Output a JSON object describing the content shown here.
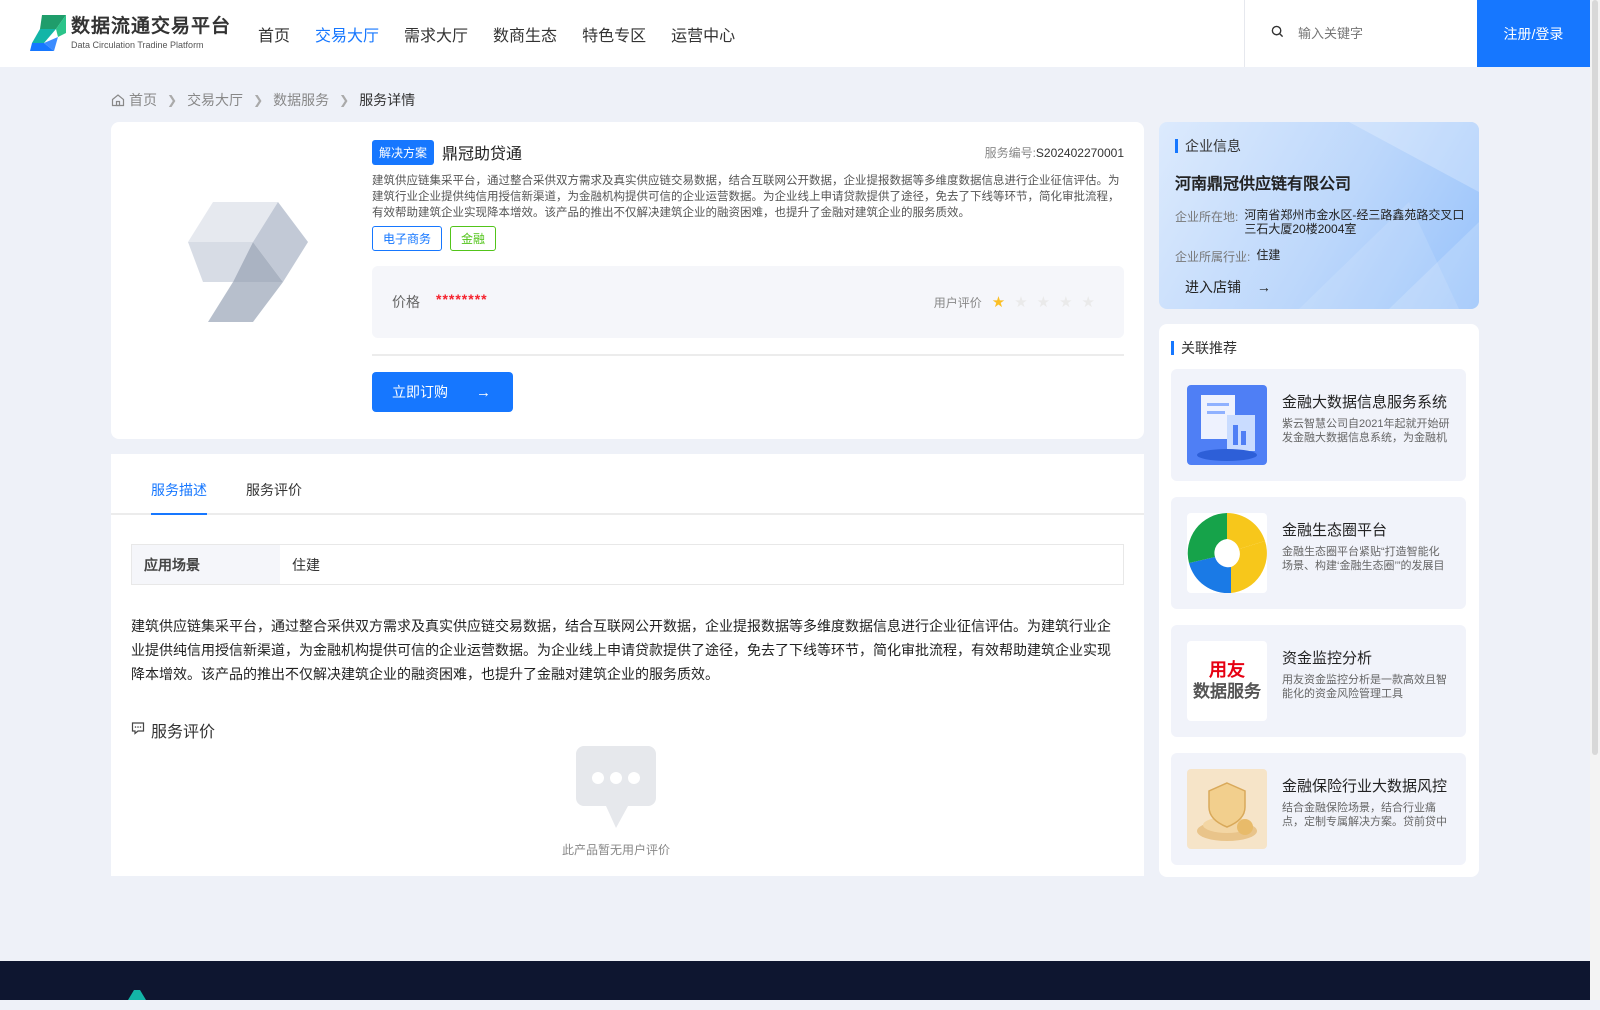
{
  "brand": {
    "name_cn": "数据流通交易平台",
    "name_en": "Data Circulation Tradine Platform"
  },
  "nav": [
    {
      "label": "首页",
      "active": false
    },
    {
      "label": "交易大厅",
      "active": true
    },
    {
      "label": "需求大厅",
      "active": false
    },
    {
      "label": "数商生态",
      "active": false
    },
    {
      "label": "特色专区",
      "active": false
    },
    {
      "label": "运营中心",
      "active": false
    }
  ],
  "search": {
    "placeholder": "输入关键字"
  },
  "login_label": "注册/登录",
  "breadcrumb": [
    "首页",
    "交易大厅",
    "数据服务",
    "服务详情"
  ],
  "product": {
    "badge": "解决方案",
    "title": "鼎冠助贷通",
    "service_no_label": "服务编号:",
    "service_no": "S202402270001",
    "desc": "建筑供应链集采平台，通过整合采供双方需求及真实供应链交易数据，结合互联网公开数据，企业提报数据等多维度数据信息进行企业征信评估。为建筑行业企业提供纯信用授信新渠道，为金融机构提供可信的企业运营数据。为企业线上申请贷款提供了途径，免去了下线等环节，简化审批流程，有效帮助建筑企业实现降本增效。该产品的推出不仅解决建筑企业的融资困难，也提升了金融对建筑企业的服务质效。",
    "tags": [
      "电子商务",
      "金融"
    ],
    "price_label": "价格",
    "price_value": "********",
    "rating_label": "用户评价",
    "rating": 1,
    "rating_max": 5,
    "order_label": "立即订购"
  },
  "tabs": [
    "服务描述",
    "服务评价"
  ],
  "scene": {
    "label": "应用场景",
    "value": "住建"
  },
  "full_desc": "建筑供应链集采平台，通过整合采供双方需求及真实供应链交易数据，结合互联网公开数据，企业提报数据等多维度数据信息进行企业征信评估。为建筑行业企业提供纯信用授信新渠道，为金融机构提供可信的企业运营数据。为企业线上申请贷款提供了途径，免去了下线等环节，简化审批流程，有效帮助建筑企业实现降本增效。该产品的推出不仅解决建筑企业的融资困难，也提升了金融对建筑企业的服务质效。",
  "review": {
    "title": "服务评价",
    "empty_text": "此产品暂无用户评价"
  },
  "company": {
    "section_title": "企业信息",
    "name": "河南鼎冠供应链有限公司",
    "location_label": "企业所在地:",
    "location": "河南省郑州市金水区-经三路鑫苑路交叉口三石大厦20楼2004室",
    "industry_label": "企业所属行业:",
    "industry": "住建",
    "shop_link": "进入店铺"
  },
  "recommend": {
    "section_title": "关联推荐",
    "items": [
      {
        "title": "金融大数据信息服务系统",
        "desc": "紫云智慧公司自2021年起就开始研发金融大数据信息系统，为金融机构提供数据服务"
      },
      {
        "title": "金融生态圈平台",
        "desc": "金融生态圈平台紧贴“打造智能化场景、构建‘金融生态圈’”的发展目标"
      },
      {
        "title": "资金监控分析",
        "desc": "用友资金监控分析是一款高效且智能化的资金风险管理工具"
      },
      {
        "title": "金融保险行业大数据风控",
        "desc": "结合金融保险场景，结合行业痛点，定制专属解决方案。贷前贷中贷后全流程"
      }
    ],
    "thumb_labels": [
      "用友",
      "数据服务"
    ]
  },
  "colors": {
    "primary": "#1677ff",
    "price": "#f5222d",
    "star": "#fbbf24",
    "tag_green": "#52c41a",
    "footer": "#0e1630"
  }
}
